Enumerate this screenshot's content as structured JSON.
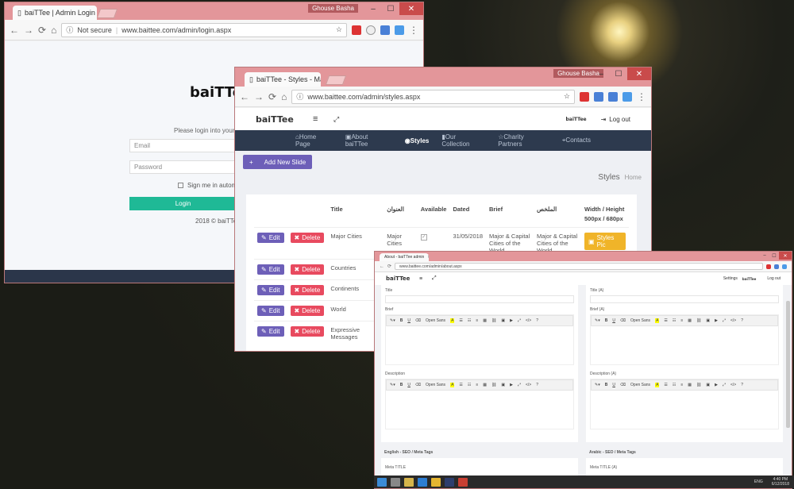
{
  "win1": {
    "tab": "baiTTee | Admin Login",
    "user": "Ghouse Basha",
    "url_prefix": "Not secure",
    "url": "www.baittee.com/admin/login.aspx",
    "brand": "baiTTee",
    "prompt": "Please login into your a",
    "email_placeholder": "Email",
    "password_placeholder": "Password",
    "remember": "Sign me in automa",
    "login": "Login",
    "footer": "2018 © baiTTee"
  },
  "win2": {
    "tab": "baiTTee - Styles - Manag",
    "user": "Ghouse Basha",
    "url": "www.baittee.com/admin/styles.aspx",
    "brand": "baiTTee",
    "logo_small": "baiTTee",
    "logout": "Log out",
    "nav": [
      {
        "label": "Home Page",
        "icon": "home-icon"
      },
      {
        "label": "About baiTTee",
        "icon": "briefcase-icon"
      },
      {
        "label": "Styles",
        "icon": "eye-icon"
      },
      {
        "label": "Our Collection",
        "icon": "bookmark-icon"
      },
      {
        "label": "Charity Partners",
        "icon": "star-icon"
      },
      {
        "label": "Contacts",
        "icon": "location-icon"
      }
    ],
    "add_slide": "Add New Slide",
    "breadcrumb_title": "Styles",
    "breadcrumb_home": "Home",
    "headers": [
      "Title",
      "العنوان",
      "Available",
      "Dated",
      "Brief",
      "الملخص",
      "Width / Height",
      "500px / 680px"
    ],
    "edit": "Edit",
    "delete": "Delete",
    "styles_pic": "Styles Pic",
    "rows": [
      {
        "title": "Major Cities",
        "title_ar": "Major Cities",
        "dated": "31/05/2018",
        "brief": "Major & Capital Cities of the World",
        "brief_ar": "Major & Capital Cities of the World"
      },
      {
        "title": "Countries"
      },
      {
        "title": "Continents"
      },
      {
        "title": "World"
      },
      {
        "title": "Expressive Messages"
      }
    ]
  },
  "win3": {
    "tab": "About - baiTTee admin",
    "url": "www.baittee.com/admin/about.aspx",
    "brand": "baiTTee",
    "settings": "Settings",
    "logo_small": "baiTTee",
    "logout": "Log out",
    "left": {
      "title": "Title",
      "brief": "Brief",
      "description": "Description",
      "seo": "English - SEO / Meta Tags",
      "meta": "Meta TITLE"
    },
    "right": {
      "title": "Title (A)",
      "brief": "Brief (A)",
      "description": "Description (A)",
      "seo": "Arabic - SEO / Meta Tags",
      "meta": "Meta TITLE (A)"
    },
    "font": "Open Sans"
  },
  "taskbar": {
    "clock": "4:40 PM",
    "date": "6/12/2018",
    "lang": "ENG"
  }
}
